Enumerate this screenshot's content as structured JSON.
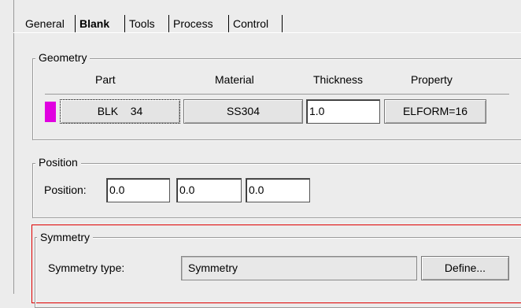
{
  "tabs": [
    {
      "label": "General"
    },
    {
      "label": "Blank"
    },
    {
      "label": "Tools"
    },
    {
      "label": "Process"
    },
    {
      "label": "Control"
    }
  ],
  "geometry": {
    "title": "Geometry",
    "headers": [
      "Part",
      "Material",
      "Thickness",
      "Property"
    ],
    "row": {
      "part_name": "BLK",
      "part_id": "34",
      "material": "SS304",
      "thickness": "1.0",
      "property": "ELFORM=16",
      "color": "#e000e0"
    }
  },
  "position": {
    "title": "Position",
    "label": "Position:",
    "x": "0.0",
    "y": "0.0",
    "z": "0.0"
  },
  "symmetry": {
    "title": "Symmetry",
    "type_label": "Symmetry type:",
    "type_value": "Symmetry",
    "define_label": "Define...",
    "highlight_color": "#e00000"
  }
}
